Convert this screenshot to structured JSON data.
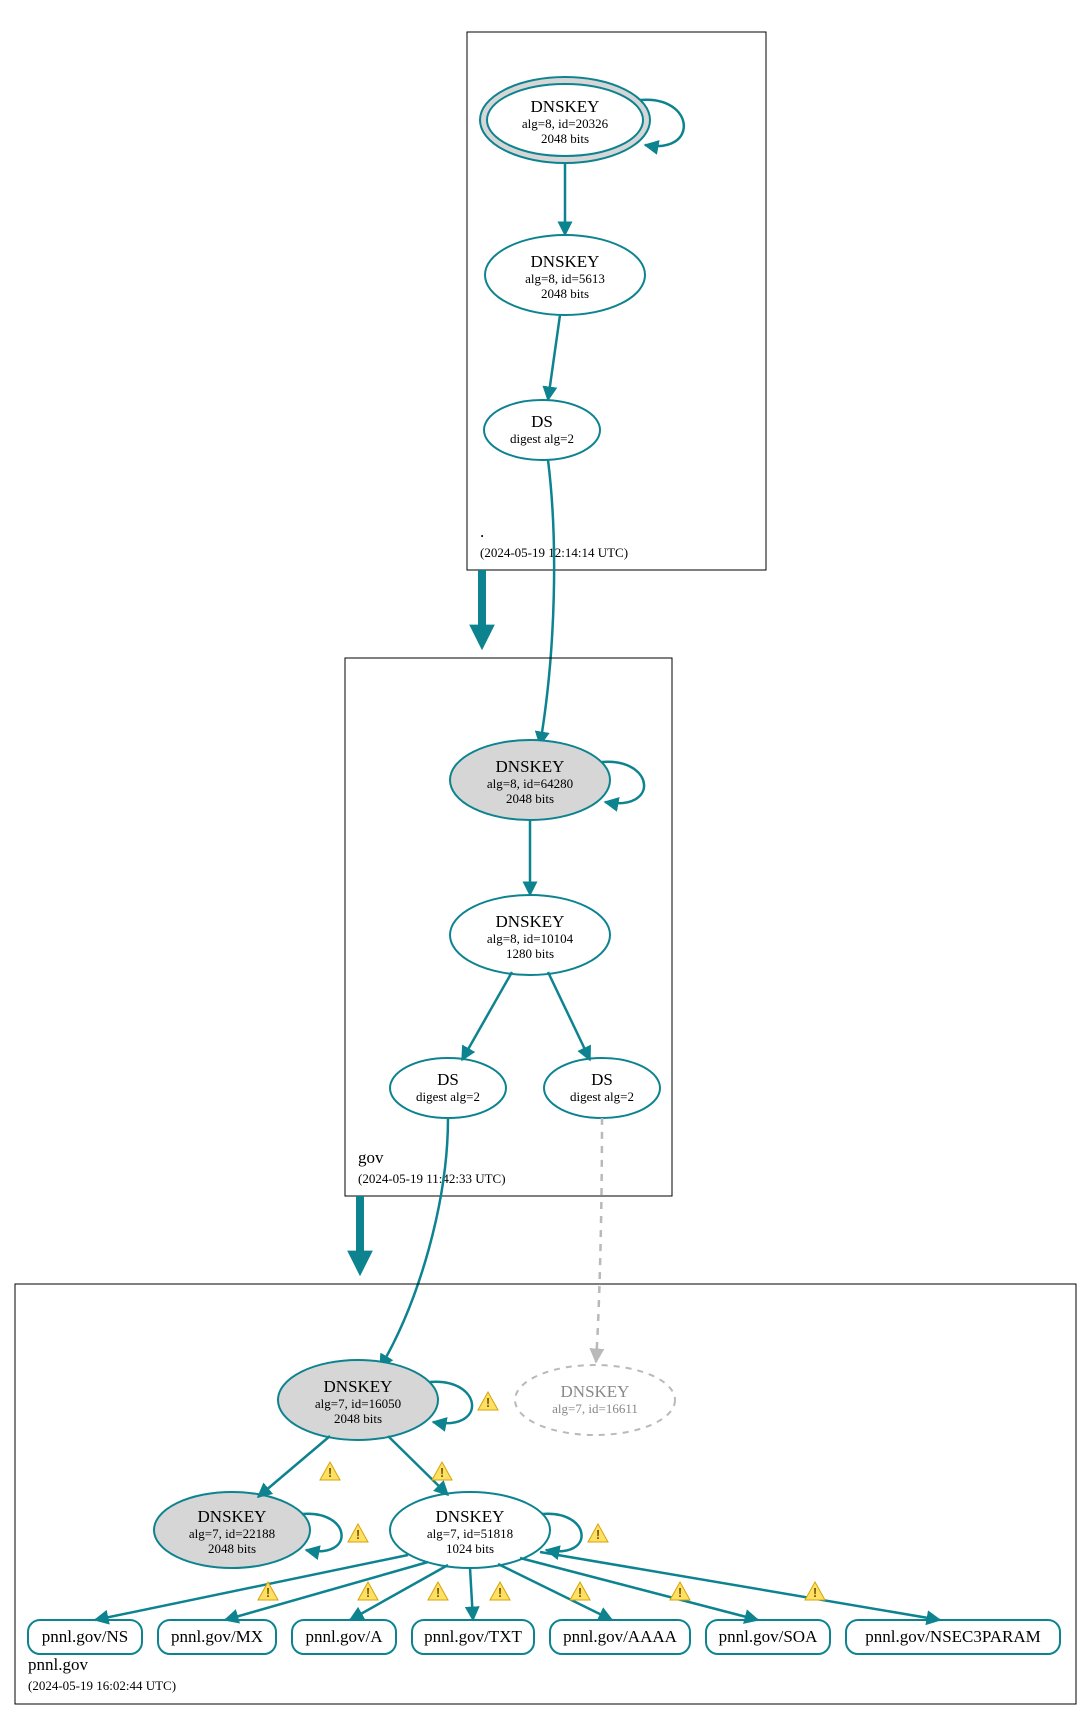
{
  "colors": {
    "teal": "#0d8390",
    "grey": "#b9b9b9",
    "boxStroke": "#000000",
    "shaded": "#d6d6d6"
  },
  "zones": {
    "root": {
      "name": ".",
      "timestamp": "(2024-05-19 12:14:14 UTC)"
    },
    "gov": {
      "name": "gov",
      "timestamp": "(2024-05-19 11:42:33 UTC)"
    },
    "pnnl": {
      "name": "pnnl.gov",
      "timestamp": "(2024-05-19 16:02:44 UTC)"
    }
  },
  "nodes": {
    "root_ksk": {
      "title": "DNSKEY",
      "line2": "alg=8, id=20326",
      "line3": "2048 bits"
    },
    "root_zsk": {
      "title": "DNSKEY",
      "line2": "alg=8, id=5613",
      "line3": "2048 bits"
    },
    "root_ds": {
      "title": "DS",
      "line2": "digest alg=2"
    },
    "gov_ksk": {
      "title": "DNSKEY",
      "line2": "alg=8, id=64280",
      "line3": "2048 bits"
    },
    "gov_zsk": {
      "title": "DNSKEY",
      "line2": "alg=8, id=10104",
      "line3": "1280 bits"
    },
    "gov_ds1": {
      "title": "DS",
      "line2": "digest alg=2"
    },
    "gov_ds2": {
      "title": "DS",
      "line2": "digest alg=2"
    },
    "pnnl_ksk": {
      "title": "DNSKEY",
      "line2": "alg=7, id=16050",
      "line3": "2048 bits"
    },
    "pnnl_ghost": {
      "title": "DNSKEY",
      "line2": "alg=7, id=16611"
    },
    "pnnl_ksk2": {
      "title": "DNSKEY",
      "line2": "alg=7, id=22188",
      "line3": "2048 bits"
    },
    "pnnl_zsk": {
      "title": "DNSKEY",
      "line2": "alg=7, id=51818",
      "line3": "1024 bits"
    }
  },
  "rrsets": {
    "ns": "pnnl.gov/NS",
    "mx": "pnnl.gov/MX",
    "a": "pnnl.gov/A",
    "txt": "pnnl.gov/TXT",
    "aaaa": "pnnl.gov/AAAA",
    "soa": "pnnl.gov/SOA",
    "nsec3": "pnnl.gov/NSEC3PARAM"
  }
}
